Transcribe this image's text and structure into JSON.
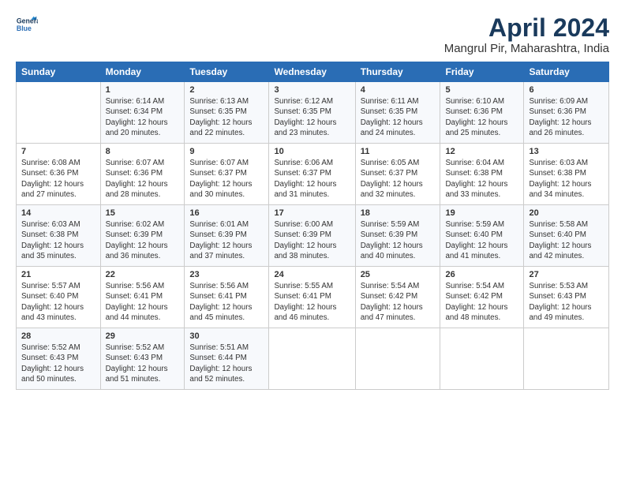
{
  "header": {
    "logo_line1": "General",
    "logo_line2": "Blue",
    "title": "April 2024",
    "subtitle": "Mangrul Pir, Maharashtra, India"
  },
  "columns": [
    "Sunday",
    "Monday",
    "Tuesday",
    "Wednesday",
    "Thursday",
    "Friday",
    "Saturday"
  ],
  "weeks": [
    [
      {
        "day": "",
        "content": ""
      },
      {
        "day": "1",
        "content": "Sunrise: 6:14 AM\nSunset: 6:34 PM\nDaylight: 12 hours\nand 20 minutes."
      },
      {
        "day": "2",
        "content": "Sunrise: 6:13 AM\nSunset: 6:35 PM\nDaylight: 12 hours\nand 22 minutes."
      },
      {
        "day": "3",
        "content": "Sunrise: 6:12 AM\nSunset: 6:35 PM\nDaylight: 12 hours\nand 23 minutes."
      },
      {
        "day": "4",
        "content": "Sunrise: 6:11 AM\nSunset: 6:35 PM\nDaylight: 12 hours\nand 24 minutes."
      },
      {
        "day": "5",
        "content": "Sunrise: 6:10 AM\nSunset: 6:36 PM\nDaylight: 12 hours\nand 25 minutes."
      },
      {
        "day": "6",
        "content": "Sunrise: 6:09 AM\nSunset: 6:36 PM\nDaylight: 12 hours\nand 26 minutes."
      }
    ],
    [
      {
        "day": "7",
        "content": "Sunrise: 6:08 AM\nSunset: 6:36 PM\nDaylight: 12 hours\nand 27 minutes."
      },
      {
        "day": "8",
        "content": "Sunrise: 6:07 AM\nSunset: 6:36 PM\nDaylight: 12 hours\nand 28 minutes."
      },
      {
        "day": "9",
        "content": "Sunrise: 6:07 AM\nSunset: 6:37 PM\nDaylight: 12 hours\nand 30 minutes."
      },
      {
        "day": "10",
        "content": "Sunrise: 6:06 AM\nSunset: 6:37 PM\nDaylight: 12 hours\nand 31 minutes."
      },
      {
        "day": "11",
        "content": "Sunrise: 6:05 AM\nSunset: 6:37 PM\nDaylight: 12 hours\nand 32 minutes."
      },
      {
        "day": "12",
        "content": "Sunrise: 6:04 AM\nSunset: 6:38 PM\nDaylight: 12 hours\nand 33 minutes."
      },
      {
        "day": "13",
        "content": "Sunrise: 6:03 AM\nSunset: 6:38 PM\nDaylight: 12 hours\nand 34 minutes."
      }
    ],
    [
      {
        "day": "14",
        "content": "Sunrise: 6:03 AM\nSunset: 6:38 PM\nDaylight: 12 hours\nand 35 minutes."
      },
      {
        "day": "15",
        "content": "Sunrise: 6:02 AM\nSunset: 6:39 PM\nDaylight: 12 hours\nand 36 minutes."
      },
      {
        "day": "16",
        "content": "Sunrise: 6:01 AM\nSunset: 6:39 PM\nDaylight: 12 hours\nand 37 minutes."
      },
      {
        "day": "17",
        "content": "Sunrise: 6:00 AM\nSunset: 6:39 PM\nDaylight: 12 hours\nand 38 minutes."
      },
      {
        "day": "18",
        "content": "Sunrise: 5:59 AM\nSunset: 6:39 PM\nDaylight: 12 hours\nand 40 minutes."
      },
      {
        "day": "19",
        "content": "Sunrise: 5:59 AM\nSunset: 6:40 PM\nDaylight: 12 hours\nand 41 minutes."
      },
      {
        "day": "20",
        "content": "Sunrise: 5:58 AM\nSunset: 6:40 PM\nDaylight: 12 hours\nand 42 minutes."
      }
    ],
    [
      {
        "day": "21",
        "content": "Sunrise: 5:57 AM\nSunset: 6:40 PM\nDaylight: 12 hours\nand 43 minutes."
      },
      {
        "day": "22",
        "content": "Sunrise: 5:56 AM\nSunset: 6:41 PM\nDaylight: 12 hours\nand 44 minutes."
      },
      {
        "day": "23",
        "content": "Sunrise: 5:56 AM\nSunset: 6:41 PM\nDaylight: 12 hours\nand 45 minutes."
      },
      {
        "day": "24",
        "content": "Sunrise: 5:55 AM\nSunset: 6:41 PM\nDaylight: 12 hours\nand 46 minutes."
      },
      {
        "day": "25",
        "content": "Sunrise: 5:54 AM\nSunset: 6:42 PM\nDaylight: 12 hours\nand 47 minutes."
      },
      {
        "day": "26",
        "content": "Sunrise: 5:54 AM\nSunset: 6:42 PM\nDaylight: 12 hours\nand 48 minutes."
      },
      {
        "day": "27",
        "content": "Sunrise: 5:53 AM\nSunset: 6:43 PM\nDaylight: 12 hours\nand 49 minutes."
      }
    ],
    [
      {
        "day": "28",
        "content": "Sunrise: 5:52 AM\nSunset: 6:43 PM\nDaylight: 12 hours\nand 50 minutes."
      },
      {
        "day": "29",
        "content": "Sunrise: 5:52 AM\nSunset: 6:43 PM\nDaylight: 12 hours\nand 51 minutes."
      },
      {
        "day": "30",
        "content": "Sunrise: 5:51 AM\nSunset: 6:44 PM\nDaylight: 12 hours\nand 52 minutes."
      },
      {
        "day": "",
        "content": ""
      },
      {
        "day": "",
        "content": ""
      },
      {
        "day": "",
        "content": ""
      },
      {
        "day": "",
        "content": ""
      }
    ]
  ]
}
